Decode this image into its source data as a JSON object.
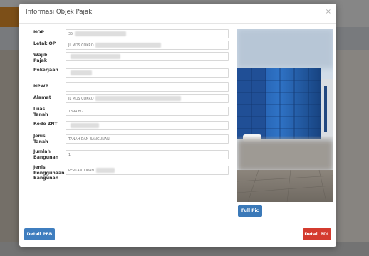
{
  "modal": {
    "title": "Informasi Objek Pajak",
    "close_glyph": "×"
  },
  "form": {
    "fields": [
      {
        "label": "NOP",
        "value": "35"
      },
      {
        "label": "Letak OP",
        "value": "JL MOS COKRO"
      },
      {
        "label": "Wajib Pajak",
        "value": ""
      },
      {
        "label": "Pekerjaan",
        "value": ""
      },
      {
        "label": "NPWP",
        "value": "-"
      },
      {
        "label": "Alamat",
        "value": "JL MOS COKRO"
      },
      {
        "label": "Luas Tanah",
        "value": "1394 m2"
      },
      {
        "label": "Kode ZNT",
        "value": ""
      },
      {
        "label": "Jenis Tanah",
        "value": "TANAH DAN BANGUNAN"
      },
      {
        "label": "Jumlah Bangunan",
        "value": "1"
      },
      {
        "label": "Jenis Penggunaan Bangunan",
        "value": "PERKANTORAN"
      }
    ]
  },
  "buttons": {
    "full_pic": "Full Pic",
    "detail_pbb": "Detail PBB",
    "detail_pdl": "Detail PDL"
  },
  "colors": {
    "primary": "#3b79b8",
    "danger": "#d43b2f"
  }
}
